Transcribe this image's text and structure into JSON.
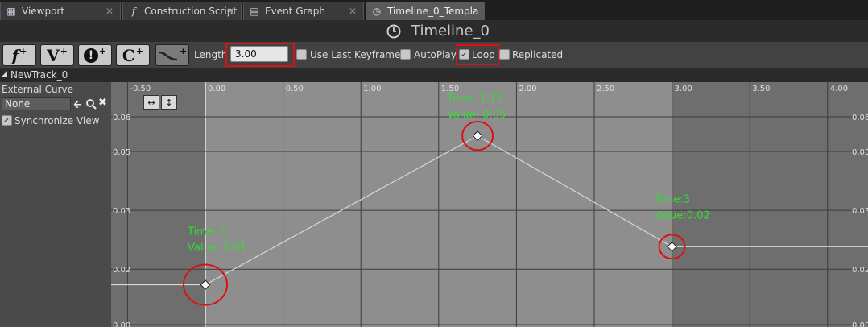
{
  "tabs": [
    {
      "label": "Viewport",
      "icon": "grid-icon"
    },
    {
      "label": "Construction Script",
      "icon": "function-icon"
    },
    {
      "label": "Event Graph",
      "icon": "graph-icon"
    },
    {
      "label": "Timeline_0_Templa",
      "icon": "clock-icon"
    }
  ],
  "title": "Timeline_0",
  "toolbar": {
    "buttons": [
      {
        "glyph": "f",
        "plus": "+",
        "icon": "add-float-track-icon"
      },
      {
        "glyph": "V",
        "plus": "+",
        "icon": "add-vector-track-icon"
      },
      {
        "glyph": "!",
        "plus": "+",
        "icon": "add-event-track-icon"
      },
      {
        "glyph": "C",
        "plus": "+",
        "icon": "add-color-track-icon"
      },
      {
        "glyph": "",
        "plus": "+",
        "icon": "add-curve-icon"
      }
    ],
    "length_label": "Length",
    "length_value": "3.00",
    "use_last_keyframe_label": "Use Last Keyframe?",
    "use_last_keyframe": false,
    "autoplay_label": "AutoPlay",
    "autoplay": false,
    "loop_label": "Loop",
    "loop": true,
    "replicated_label": "Replicated",
    "replicated": false,
    "highlight_color": "#dd1111"
  },
  "track": {
    "name": "NewTrack_0",
    "external_curve_label": "External Curve",
    "curve_value": "None",
    "sync_view_label": "Synchronize View",
    "sync_view": true
  },
  "colors": {
    "annotation": "#33dd33",
    "active_range": "#8e8e8e",
    "outside_range": "#6e6e6e",
    "curve": "#d8d8d8",
    "marker_circle": "#dd1111"
  },
  "chart_data": {
    "type": "line",
    "x_ticks": [
      "-0.50",
      "0.00",
      "0.50",
      "1.00",
      "1.50",
      "2.00",
      "2.50",
      "3.00",
      "3.50",
      "4.00"
    ],
    "y_ticks": [
      "0.06",
      "0.05",
      "0.03",
      "0.02",
      "0.00"
    ],
    "xlim": [
      -0.6,
      4.25
    ],
    "ylim": [
      0.0,
      0.062
    ],
    "active_range": [
      0,
      3
    ],
    "keys": [
      {
        "x": 0,
        "y": 0.01,
        "label_time": "Time: 0",
        "label_value": "Value: 0.01"
      },
      {
        "x": 1.75,
        "y": 0.05,
        "label_time": "Time: 1.75",
        "label_value": "Value: 0.05"
      },
      {
        "x": 3,
        "y": 0.02,
        "label_time": "Time:3",
        "label_value": "Value:0.02"
      }
    ]
  }
}
